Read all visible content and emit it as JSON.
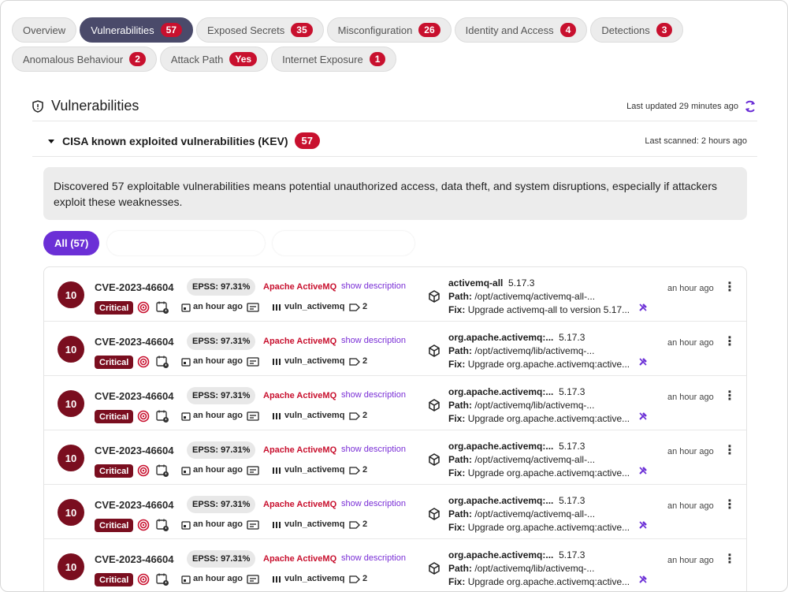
{
  "tabs": [
    {
      "label": "Overview",
      "count": ""
    },
    {
      "label": "Vulnerabilities",
      "count": "57",
      "active": true
    },
    {
      "label": "Exposed Secrets",
      "count": "35"
    },
    {
      "label": "Misconfiguration",
      "count": "26"
    },
    {
      "label": "Identity and Access",
      "count": "4"
    },
    {
      "label": "Detections",
      "count": "3"
    },
    {
      "label": "Anomalous Behaviour",
      "count": "2"
    },
    {
      "label": "Attack Path",
      "count": "Yes"
    },
    {
      "label": "Internet Exposure",
      "count": "1"
    }
  ],
  "section": {
    "title": "Vulnerabilities",
    "last_updated": "Last updated 29 minutes ago"
  },
  "kev": {
    "title": "CISA known exploited vulnerabilities (KEV)",
    "count": "57",
    "last_scanned": "Last scanned: 2 hours ago"
  },
  "notice": "Discovered 57 exploitable vulnerabilities means potential unauthorized access, data theft, and system disruptions, especially if attackers exploit these weaknesses.",
  "filters": {
    "all": "All (57)"
  },
  "colors": {
    "accent": "#6b2fd6",
    "critical": "#7a0e1f",
    "badge": "#c8102e"
  },
  "rows": [
    {
      "score": "10",
      "cve": "CVE-2023-46604",
      "epss": "EPSS: 97.31%",
      "vendor": "Apache ActiveMQ",
      "show": "show description",
      "severity": "Critical",
      "time": "an hour ago",
      "image": "vuln_activemq",
      "tags": "2",
      "pkg_name": "activemq-all",
      "pkg_ver": "5.17.3",
      "path_label": "Path:",
      "path": "/opt/activemq/activemq-all-...",
      "fix_label": "Fix:",
      "fix": "Upgrade activemq-all to version 5.17...",
      "ago": "an hour ago"
    },
    {
      "score": "10",
      "cve": "CVE-2023-46604",
      "epss": "EPSS: 97.31%",
      "vendor": "Apache ActiveMQ",
      "show": "show description",
      "severity": "Critical",
      "time": "an hour ago",
      "image": "vuln_activemq",
      "tags": "2",
      "pkg_name": "org.apache.activemq:...",
      "pkg_ver": "5.17.3",
      "path_label": "Path:",
      "path": "/opt/activemq/lib/activemq-...",
      "fix_label": "Fix:",
      "fix": "Upgrade org.apache.activemq:active...",
      "ago": "an hour ago"
    },
    {
      "score": "10",
      "cve": "CVE-2023-46604",
      "epss": "EPSS: 97.31%",
      "vendor": "Apache ActiveMQ",
      "show": "show description",
      "severity": "Critical",
      "time": "an hour ago",
      "image": "vuln_activemq",
      "tags": "2",
      "pkg_name": "org.apache.activemq:...",
      "pkg_ver": "5.17.3",
      "path_label": "Path:",
      "path": "/opt/activemq/lib/activemq-...",
      "fix_label": "Fix:",
      "fix": "Upgrade org.apache.activemq:active...",
      "ago": "an hour ago"
    },
    {
      "score": "10",
      "cve": "CVE-2023-46604",
      "epss": "EPSS: 97.31%",
      "vendor": "Apache ActiveMQ",
      "show": "show description",
      "severity": "Critical",
      "time": "an hour ago",
      "image": "vuln_activemq",
      "tags": "2",
      "pkg_name": "org.apache.activemq:...",
      "pkg_ver": "5.17.3",
      "path_label": "Path:",
      "path": "/opt/activemq/activemq-all-...",
      "fix_label": "Fix:",
      "fix": "Upgrade org.apache.activemq:active...",
      "ago": "an hour ago"
    },
    {
      "score": "10",
      "cve": "CVE-2023-46604",
      "epss": "EPSS: 97.31%",
      "vendor": "Apache ActiveMQ",
      "show": "show description",
      "severity": "Critical",
      "time": "an hour ago",
      "image": "vuln_activemq",
      "tags": "2",
      "pkg_name": "org.apache.activemq:...",
      "pkg_ver": "5.17.3",
      "path_label": "Path:",
      "path": "/opt/activemq/activemq-all-...",
      "fix_label": "Fix:",
      "fix": "Upgrade org.apache.activemq:active...",
      "ago": "an hour ago"
    },
    {
      "score": "10",
      "cve": "CVE-2023-46604",
      "epss": "EPSS: 97.31%",
      "vendor": "Apache ActiveMQ",
      "show": "show description",
      "severity": "Critical",
      "time": "an hour ago",
      "image": "vuln_activemq",
      "tags": "2",
      "pkg_name": "org.apache.activemq:...",
      "pkg_ver": "5.17.3",
      "path_label": "Path:",
      "path": "/opt/activemq/lib/activemq-...",
      "fix_label": "Fix:",
      "fix": "Upgrade org.apache.activemq:active...",
      "ago": "an hour ago"
    }
  ]
}
